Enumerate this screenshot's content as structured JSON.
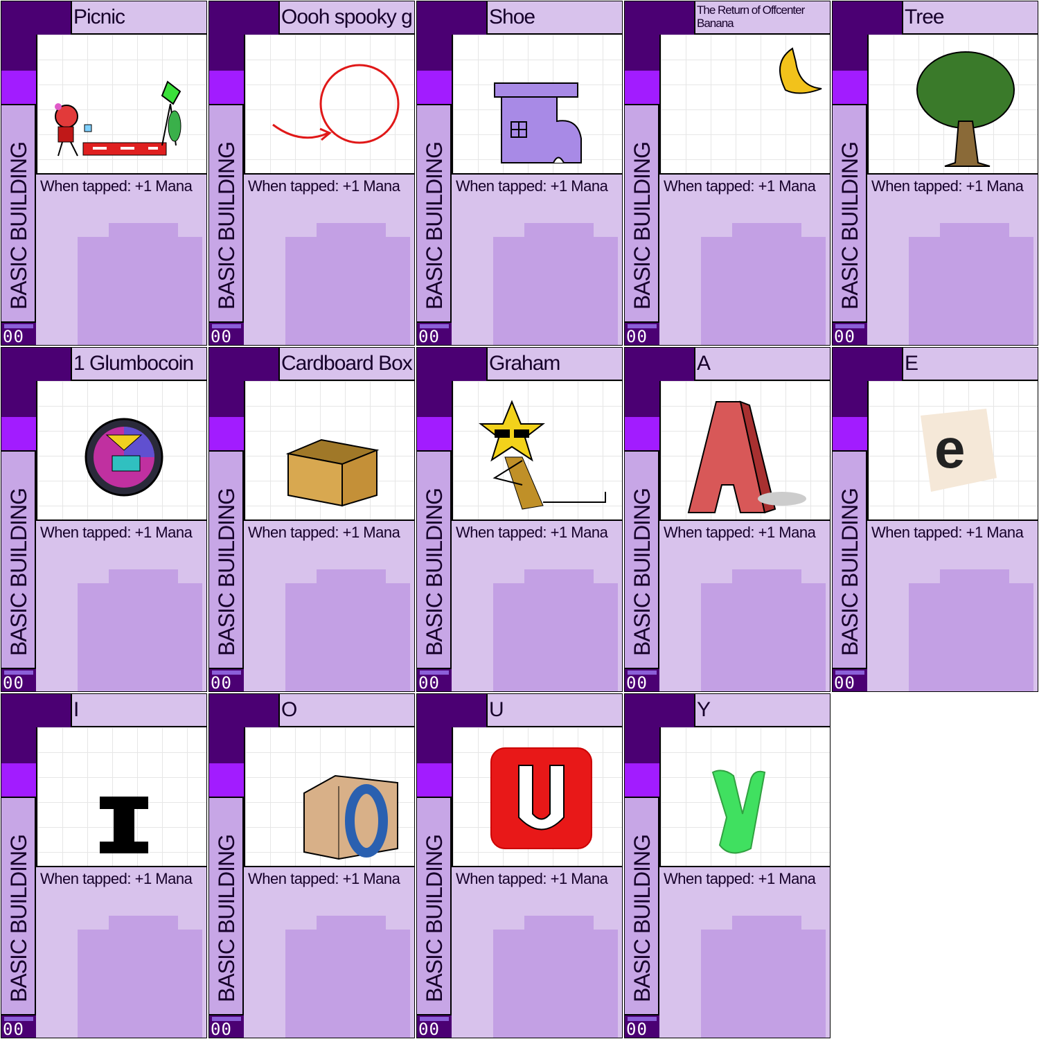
{
  "card_template": {
    "type_line": "BASIC BUILDING",
    "rules_text": "When tapped: +1 Mana",
    "cost": "00",
    "colors": {
      "frame_dark": "#4b0073",
      "frame_light": "#d8c2ec",
      "gem": "#a21cff"
    }
  },
  "cards": [
    {
      "title": "Picnic",
      "art": "picnic-illustration"
    },
    {
      "title": "Oooh spooky ghost",
      "art": "red-circle-ghost"
    },
    {
      "title": "Shoe",
      "art": "purple-boot"
    },
    {
      "title": "The Return of Offcenter Banana",
      "art": "banana"
    },
    {
      "title": "Tree",
      "art": "tree"
    },
    {
      "title": "1 Glumbocoin",
      "art": "coin"
    },
    {
      "title": "Cardboard Box",
      "art": "cardboard-box"
    },
    {
      "title": "Graham",
      "art": "star-with-sunglasses"
    },
    {
      "title": "A",
      "art": "red-letter-a"
    },
    {
      "title": "E",
      "art": "letter-e-on-paper"
    },
    {
      "title": "I",
      "art": "black-letter-i"
    },
    {
      "title": "O",
      "art": "letter-o-block"
    },
    {
      "title": "U",
      "art": "letter-u-red-tile"
    },
    {
      "title": "Y",
      "art": "green-letter-y"
    }
  ]
}
